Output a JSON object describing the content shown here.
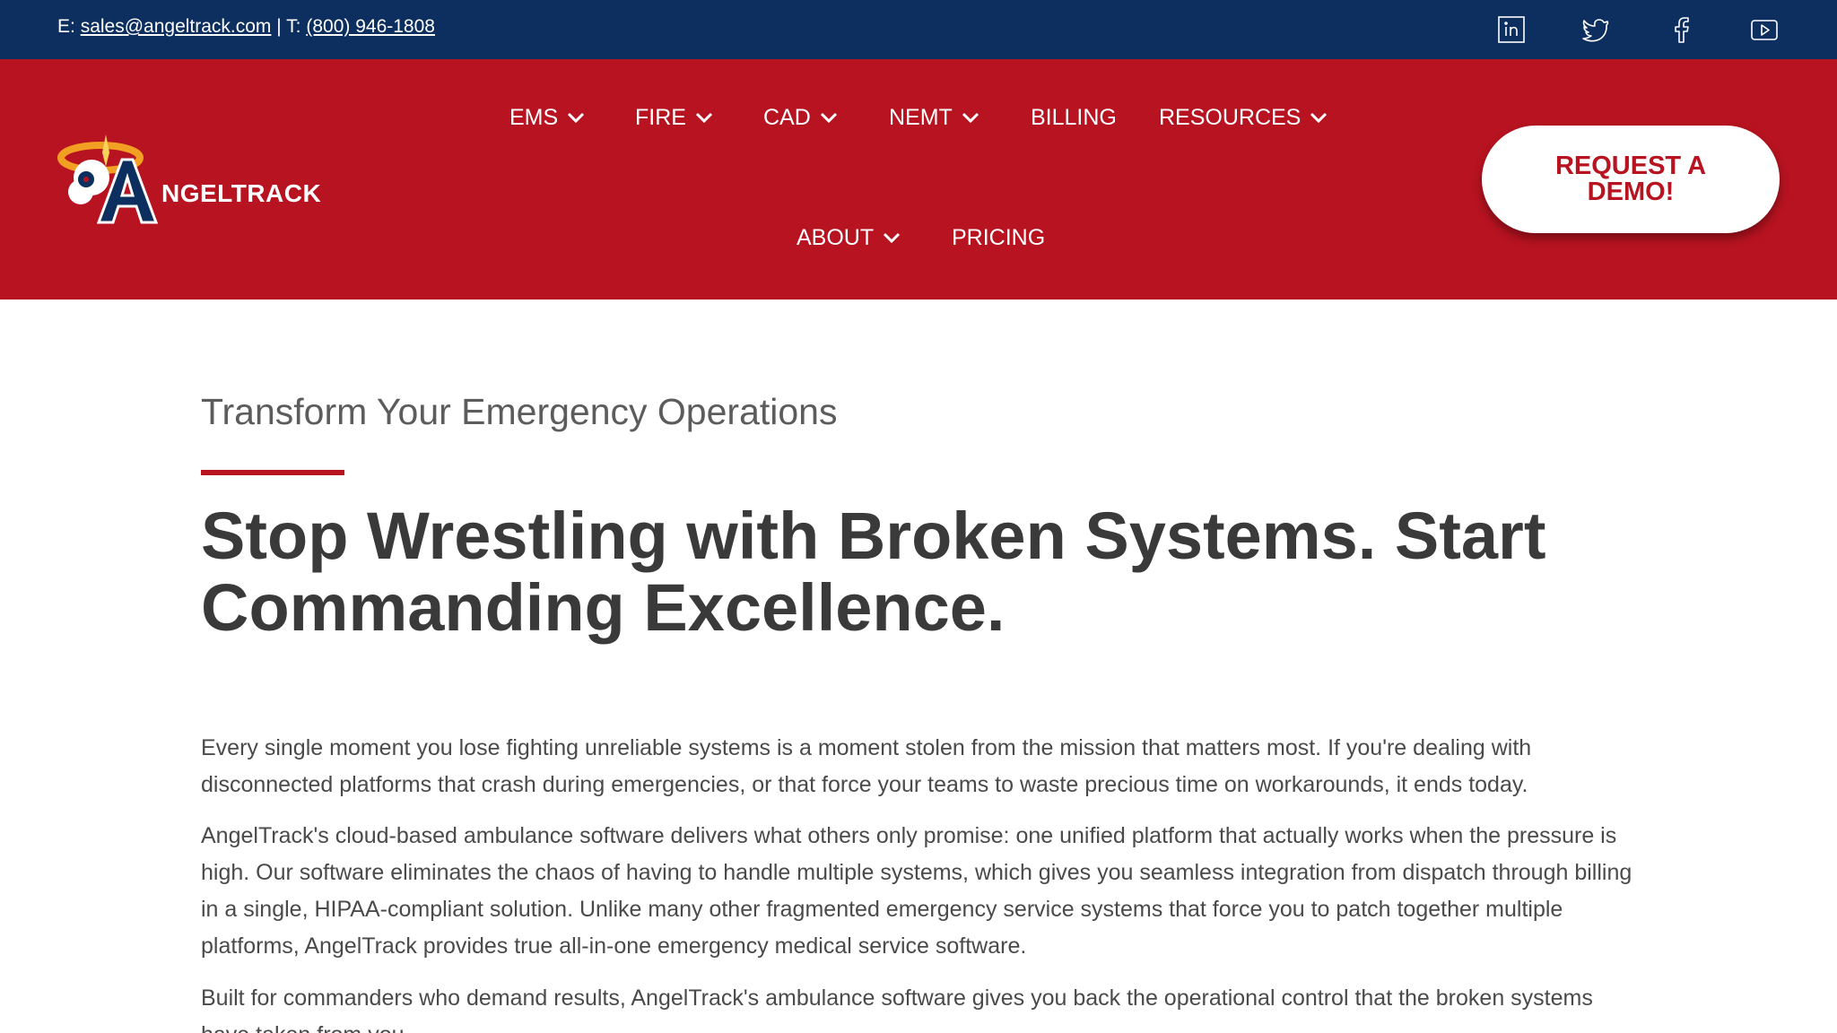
{
  "topbar": {
    "email_prefix": "E: ",
    "email": "sales@angeltrack.com",
    "separator": " | T: ",
    "phone": "(800) 946-1808",
    "social_icons": [
      "linkedin-icon",
      "twitter-icon",
      "facebook-icon",
      "youtube-icon"
    ]
  },
  "header": {
    "logo_text": "NGELTRACK",
    "logo_letter": "A",
    "nav": {
      "ems": "EMS",
      "fire": "FIRE",
      "cad": "CAD",
      "nemt": "NEMT",
      "billing": "BILLING",
      "resources": "RESOURCES",
      "about": "ABOUT",
      "pricing": "PRICING"
    },
    "demo_button": "REQUEST A DEMO!"
  },
  "content": {
    "eyebrow": "Transform Your Emergency Operations",
    "headline": "Stop Wrestling with Broken Systems. Start Commanding Excellence.",
    "paragraphs": [
      "Every single moment you lose fighting unreliable systems is a moment stolen from the mission that matters most. If you're dealing with disconnected platforms that crash during emergencies, or that force your teams to waste precious time on workarounds, it ends today.",
      "AngelTrack's cloud-based ambulance software delivers what others only promise: one unified platform that actually works when the pressure is high. Our software eliminates the chaos of having to handle multiple systems, which gives you seamless integration from dispatch through billing in a single, HIPAA-compliant solution. Unlike many other fragmented emergency service systems that force you to patch together multiple platforms, AngelTrack provides true all-in-one emergency medical service software.",
      "Built for commanders who demand results, AngelTrack's ambulance software gives you back the operational control that the broken systems have taken from you."
    ]
  },
  "colors": {
    "topbar": "#0d2f5f",
    "header": "#b71320",
    "accent": "#b71320",
    "text": "#3d3d3d"
  }
}
